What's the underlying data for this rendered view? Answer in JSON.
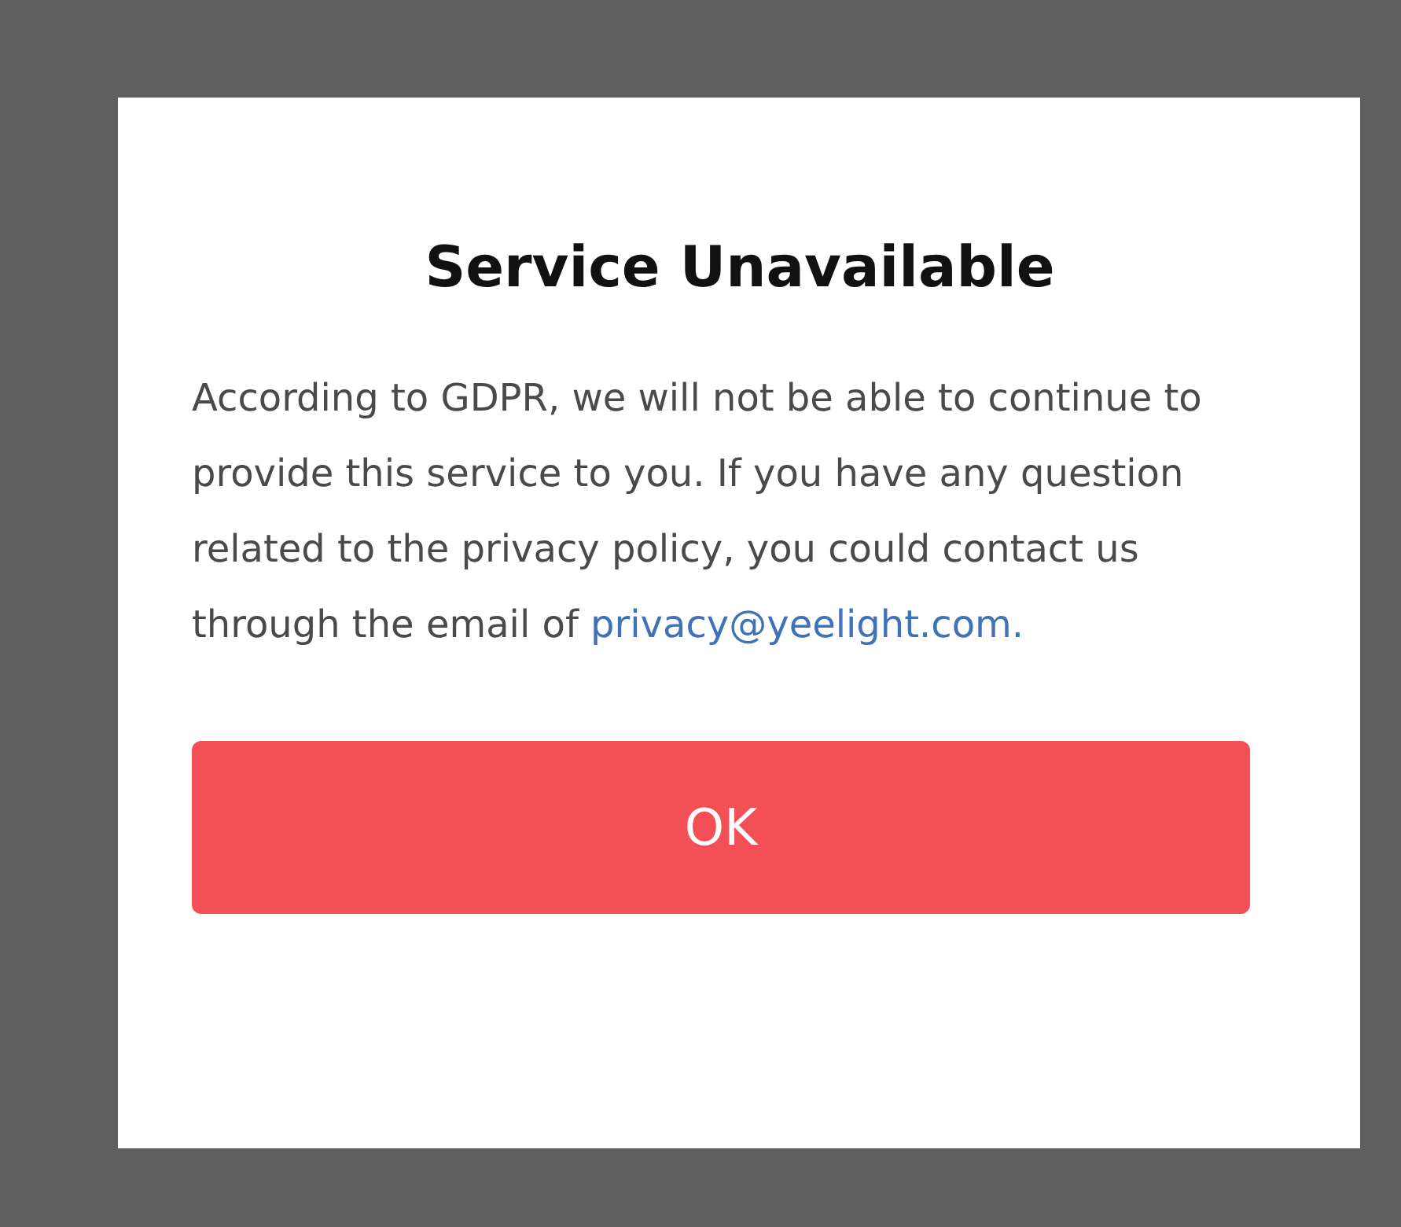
{
  "dialog": {
    "title": "Service Unavailable",
    "message": "According to GDPR, we will not be able to continue to provide this service to you. If you have any question related to the privacy policy, you could contact us through the email of ",
    "link": "privacy@yeelight.com.",
    "button": "OK"
  }
}
